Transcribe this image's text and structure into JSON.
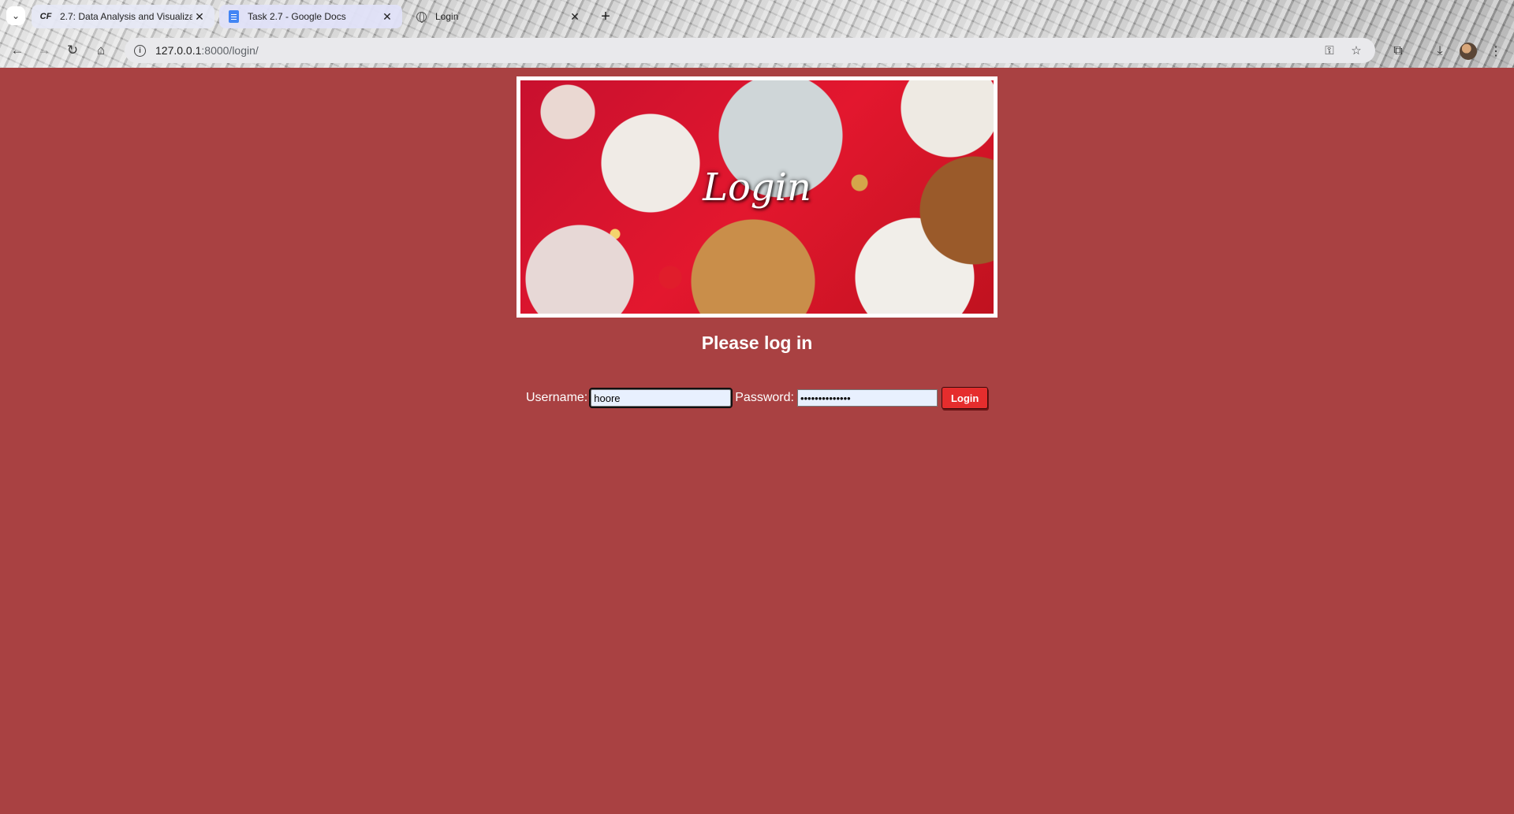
{
  "browser": {
    "tabs": [
      {
        "title": "2.7: Data Analysis and Visualiza",
        "favicon": "CF"
      },
      {
        "title": "Task 2.7 - Google Docs",
        "favicon": "google-docs-icon"
      },
      {
        "title": "Login",
        "favicon": "globe-icon",
        "active": true
      }
    ],
    "url_host": "127.0.0.1",
    "url_path": ":8000/login/"
  },
  "page": {
    "background_color": "#a94142",
    "banner_title": "Login",
    "heading": "Please log in",
    "form": {
      "username_label": "Username:",
      "username_value": "hoore",
      "password_label": "Password:",
      "password_value": "••••••••••••••",
      "submit_label": "Login",
      "submit_color": "#e52d2d"
    }
  }
}
